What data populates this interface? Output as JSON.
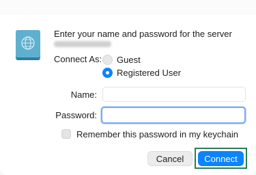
{
  "dialog": {
    "message": "Enter your name and password for the server",
    "server_name_redacted": true,
    "connect_as_label": "Connect As:",
    "options": [
      {
        "label": "Guest",
        "selected": false
      },
      {
        "label": "Registered User",
        "selected": true
      }
    ],
    "name_label": "Name:",
    "name_value": "",
    "password_label": "Password:",
    "password_value": "",
    "remember_label": "Remember this password in my keychain",
    "remember_checked": false,
    "cancel_label": "Cancel",
    "connect_label": "Connect"
  },
  "colors": {
    "accent": "#0a84ff",
    "focus_ring": "#7aa9f5",
    "highlight_box": "#2a7d5c"
  },
  "icons": {
    "server": "network-drive-icon"
  }
}
